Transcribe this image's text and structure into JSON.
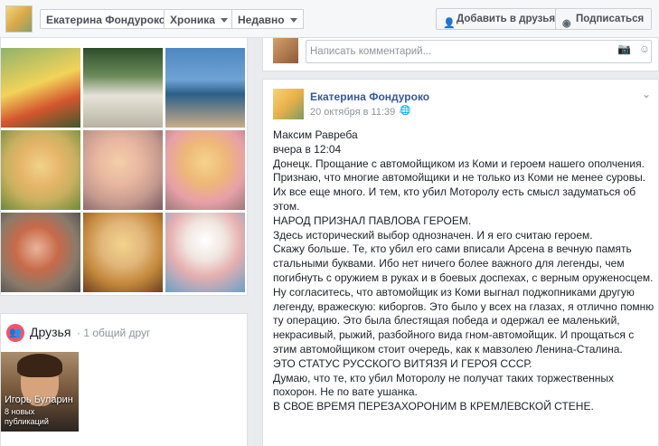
{
  "header": {
    "profile_name": "Екатерина Фондуроко",
    "timeline_label": "Хроника",
    "recent_label": "Недавно",
    "add_friend_label": "Добавить в друзья",
    "subscribe_label": "Подписаться"
  },
  "friends": {
    "title": "Друзья",
    "mutual": "· 1 общий друг",
    "friend_name": "Игорь Буларин",
    "friend_posts": "8 новых публикаций"
  },
  "comment": {
    "placeholder": "Написать комментарий..."
  },
  "post": {
    "author": "Екатерина Фондуроко",
    "time": "20 октября в 11:39 ·",
    "lines": [
      "Максим Равреба",
      "вчера в 12:04",
      "Донецк. Прощание с автомойщиком из Коми и героем нашего ополчения. Признаю, что многие автомойщики и не только из Коми не менее суровы. Их все еще много. И тем, кто убил Моторолу есть смысл задуматься об этом.",
      "НАРОД ПРИЗНАЛ ПАВЛОВА ГЕРОЕМ.",
      "Здесь исторический выбор однозначен. И я его считаю героем.",
      "Скажу больше. Те, кто убил его сами вписали Арсена в вечную память стальными буквами. Ибо нет ничего более важного для легенды, чем погибнуть с оружием в руках и в боевых доспехах, с верным оруженосцем. Ну согласитесь, что автомойщик из Коми выгнал поджопниками другую легенду, вражескую: киборгов. Это было у всех на глазах, я отлично помню ту операцию. Это была блестящая победа и одержал ее маленький, некрасивый, рыжий, разбойного вида гном-автомойщик. И прощаться с этим автомойщиком стоит очередь, как к мавзолею Ленина-Сталина.",
      "ЭТО СТАТУС РУССКОГО ВИТЯЗЯ И ГЕРОЯ СССР.",
      "Думаю, что те, кто убил Моторолу не получат таких торжественных похорон. Не по вате ушанка.",
      "В СВОЕ ВРЕМЯ ПЕРЕЗАХОРОНИМ В КРЕМЛЕВСКОЙ СТЕНЕ."
    ]
  },
  "icons": {
    "add_friend": "add-friend-icon",
    "subscribe": "rss-icon",
    "camera": "camera-icon",
    "emoji": "emoji-icon",
    "globe": "globe-icon",
    "chevron": "chevron-down-icon",
    "friends": "friends-icon"
  },
  "colors": {
    "link": "#365899",
    "background": "#e9ebee",
    "friends_badge": "#f35369"
  }
}
